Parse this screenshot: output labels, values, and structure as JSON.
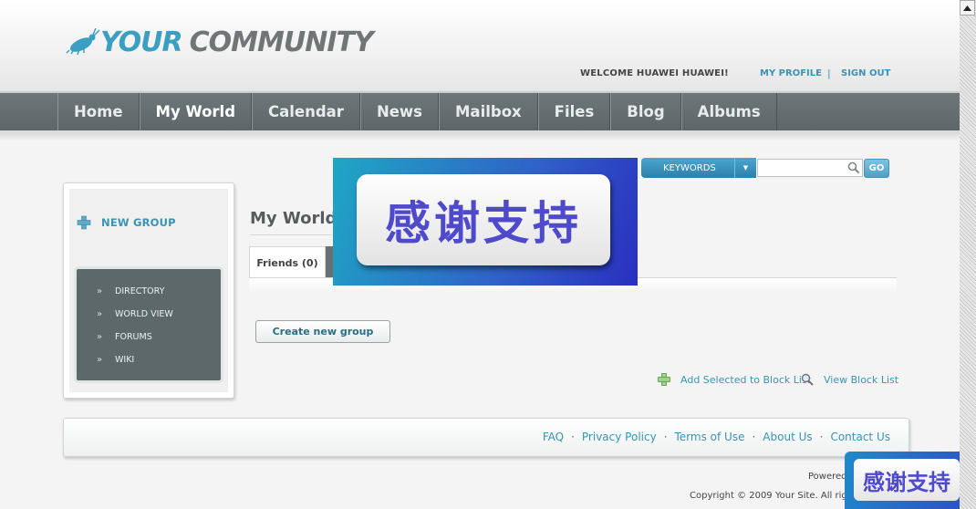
{
  "header": {
    "logo_part1": "YOUR",
    "logo_part2": "COMMUNITY",
    "welcome": "WELCOME HUAWEI HUAWEI!",
    "my_profile": "MY PROFILE",
    "separator": "|",
    "sign_out": "SIGN OUT"
  },
  "nav": {
    "items": [
      {
        "label": "Home",
        "active": false
      },
      {
        "label": "My World",
        "active": true
      },
      {
        "label": "Calendar",
        "active": false
      },
      {
        "label": "News",
        "active": false
      },
      {
        "label": "Mailbox",
        "active": false
      },
      {
        "label": "Files",
        "active": false
      },
      {
        "label": "Blog",
        "active": false
      },
      {
        "label": "Albums",
        "active": false
      }
    ]
  },
  "search": {
    "filter_label": "KEYWORDS",
    "input_value": "",
    "go_label": "GO"
  },
  "sidebar": {
    "new_group": "NEW GROUP",
    "items": [
      {
        "label": "DIRECTORY"
      },
      {
        "label": "WORLD VIEW"
      },
      {
        "label": "FORUMS"
      },
      {
        "label": "WIKI"
      }
    ],
    "bullet": "»"
  },
  "main": {
    "title": "My World",
    "tabs": [
      {
        "label": "Friends (0)"
      }
    ],
    "create_group": "Create new group",
    "add_block": "Add Selected to Block List",
    "view_block": "View Block List"
  },
  "footer": {
    "links": [
      {
        "label": "FAQ"
      },
      {
        "label": "Privacy Policy"
      },
      {
        "label": "Terms of Use"
      },
      {
        "label": "About Us"
      },
      {
        "label": "Contact Us"
      }
    ],
    "separator": "·",
    "powered": "Powered",
    "copyright": "Copyright © 2009 Your Site. All righ"
  },
  "overlays": {
    "big_text": "感谢支持",
    "small_text": "感谢支持"
  },
  "colors": {
    "accent": "#3a93b5",
    "nav_bg": "#5d6669",
    "submenu_bg": "#5d686b",
    "overlay_text": "#4f4acb"
  },
  "icons": {
    "logo": "bug-icon",
    "search": "search-icon",
    "dropdown": "chevron-down-icon",
    "new_group": "plus-icon",
    "add_block": "plus-icon",
    "view_block": "magnifier-icon",
    "scroll_up": "arrow-up-icon"
  }
}
